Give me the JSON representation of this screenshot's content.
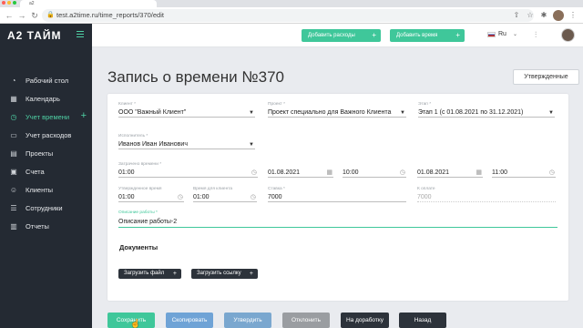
{
  "browser": {
    "tab_title": "a2",
    "url": "test.a2time.ru/time_reports/370/edit",
    "window_dots_colors": [
      "#ff5f57",
      "#febc2e",
      "#28c840"
    ]
  },
  "sidebar": {
    "logo": "A2 ТАЙМ",
    "items": [
      {
        "label": "Рабочий стол",
        "icon": "dashboard-icon",
        "active": false
      },
      {
        "label": "Календарь",
        "icon": "calendar-icon",
        "active": false
      },
      {
        "label": "Учет времени",
        "icon": "clock-icon",
        "active": true
      },
      {
        "label": "Учет расходов",
        "icon": "wallet-icon",
        "active": false
      },
      {
        "label": "Проекты",
        "icon": "folder-icon",
        "active": false
      },
      {
        "label": "Счета",
        "icon": "invoice-icon",
        "active": false
      },
      {
        "label": "Клиенты",
        "icon": "clients-icon",
        "active": false
      },
      {
        "label": "Сотрудники",
        "icon": "employees-icon",
        "active": false
      },
      {
        "label": "Отчеты",
        "icon": "reports-icon",
        "active": false
      }
    ]
  },
  "header": {
    "add_expenses": "Добавить расходы",
    "add_time": "Добавить время",
    "lang": "Ru"
  },
  "page": {
    "title": "Запись о времени №370",
    "approved_button": "Утвержденные"
  },
  "form": {
    "client": {
      "label": "Клиент *",
      "value": "ООО \"Важный Клиент\""
    },
    "project": {
      "label": "Проект *",
      "value": "Проект специально для Важного Клиента"
    },
    "stage": {
      "label": "Этап *",
      "value": "Этап 1 (с 01.08.2021 по 31.12.2021)"
    },
    "executor": {
      "label": "Исполнитель *",
      "value": "Иванов Иван Иванович"
    },
    "spent_time": {
      "label": "Затрачено времени *",
      "value": "01:00"
    },
    "start_date": {
      "value": "01.08.2021"
    },
    "start_time": {
      "value": "10:00"
    },
    "end_date": {
      "value": "01.08.2021"
    },
    "end_time": {
      "value": "11:00"
    },
    "approved_time": {
      "label": "Утвержденное время",
      "value": "01:00"
    },
    "client_time": {
      "label": "Время для клиента",
      "value": "01:00"
    },
    "rate": {
      "label": "Ставка *",
      "value": "7000"
    },
    "total": {
      "label": "К оплате",
      "value": "7000"
    },
    "description": {
      "label": "Описание работы *",
      "value": "Описание работы-2"
    },
    "documents_title": "Документы",
    "upload_file": "Загрузить файл",
    "upload_link": "Загрузить ссылку"
  },
  "actions": {
    "save": "Сохранить",
    "copy": "Скопировать",
    "approve": "Утвердить",
    "reject": "Отклонить",
    "rework": "На доработку",
    "back": "Назад"
  },
  "colors": {
    "accent": "#3fc79a",
    "sidebar_bg": "#242a33",
    "save": "#3fc79a",
    "copy": "#6fa3d6",
    "approve": "#7aa7cf",
    "reject": "#9a9da1",
    "rework": "#2d333b",
    "back": "#2d333b"
  }
}
